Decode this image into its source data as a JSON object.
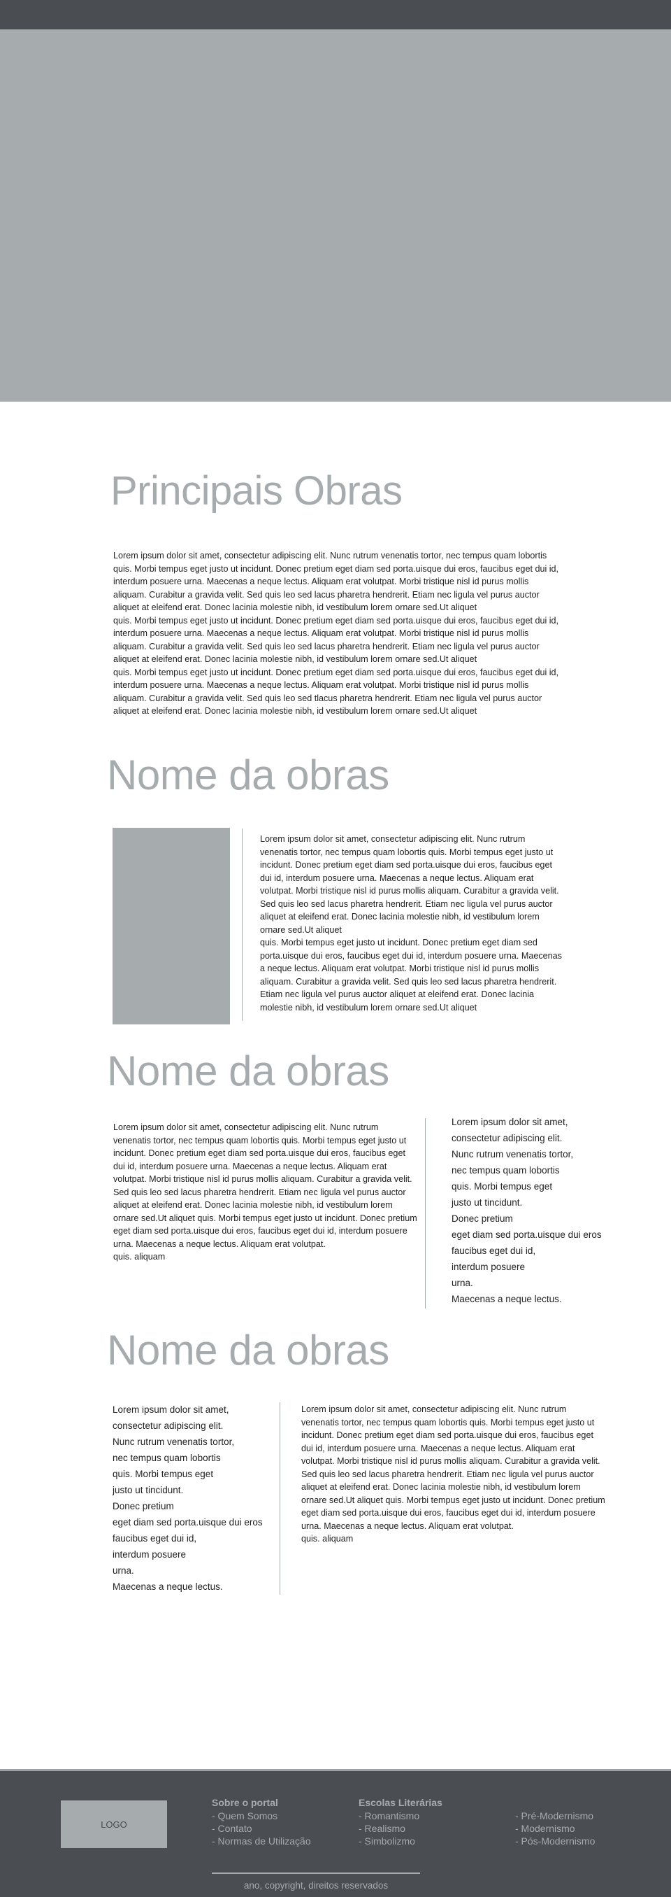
{
  "main": {
    "title": "Principais Obras",
    "intro_text": "Lorem ipsum dolor sit amet, consectetur adipiscing elit.  Nunc rutrum venenatis tortor, nec tempus quam lobortis\nquis. Morbi tempus eget justo ut incidunt. Donec pretium eget diam sed porta.uisque dui eros, faucibus eget dui id,\ninterdum posuere urna. Maecenas a neque lectus. Aliquam erat volutpat. Morbi tristique nisl id purus mollis\naliquam. Curabitur a gravida velit. Sed quis leo sed lacus pharetra hendrerit. Etiam nec ligula vel purus auctor\naliquet at eleifend erat. Donec lacinia molestie nibh, id vestibulum lorem ornare sed.Ut aliquet\nquis. Morbi tempus eget justo ut incidunt. Donec pretium eget diam sed porta.uisque dui eros, faucibus eget dui id,\ninterdum posuere urna. Maecenas a neque lectus. Aliquam erat volutpat. Morbi tristique nisl id purus mollis\naliquam. Curabitur a gravida velit. Sed quis leo sed lacus pharetra hendrerit. Etiam nec ligula vel purus auctor\naliquet at eleifend erat. Donec lacinia molestie nibh, id vestibulum lorem ornare sed.Ut aliquet\nquis. Morbi tempus eget justo ut incidunt. Donec pretium eget diam sed porta.uisque dui eros, faucibus eget dui id,\ninterdum posuere urna. Maecenas a neque lectus. Aliquam erat volutpat. Morbi tristique nisl id purus mollis\naliquam. Curabitur a gravida velit. Sed quis leo sed tlacus pharetra hendrerit. Etiam nec ligula vel purus auctor\naliquet at eleifend erat. Donec lacinia molestie nibh, id vestibulum lorem ornare sed.Ut aliquet"
  },
  "section1": {
    "title": "Nome da obras",
    "text": "Lorem ipsum dolor sit amet, consectetur adipiscing elit.  Nunc rutrum\nvenenatis tortor, nec tempus quam lobortis  quis. Morbi tempus eget justo ut\nincidunt. Donec pretium eget diam sed porta.uisque dui eros, faucibus eget\ndui id, interdum posuere urna. Maecenas a neque lectus. Aliquam erat\nvolutpat. Morbi tristique nisl id purus mollis aliquam. Curabitur a gravida velit.\nSed quis leo sed lacus pharetra hendrerit. Etiam nec ligula vel purus auctor\naliquet at eleifend erat. Donec lacinia molestie nibh, id vestibulum lorem\nornare sed.Ut aliquet\nquis. Morbi tempus eget justo ut incidunt. Donec pretium eget diam sed\nporta.uisque dui eros, faucibus eget dui id, interdum posuere urna. Maecenas\na neque lectus. Aliquam erat volutpat. Morbi tristique nisl id purus mollis\naliquam. Curabitur a gravida velit. Sed quis leo sed lacus pharetra hendrerit.\nEtiam nec ligula vel purus auctor aliquet at eleifend erat. Donec lacinia\nmolestie nibh, id vestibulum lorem ornare sed.Ut aliquet"
  },
  "section2": {
    "title": "Nome da obras",
    "text": "Lorem ipsum dolor sit amet, consectetur adipiscing elit.  Nunc rutrum\nvenenatis tortor, nec tempus quam lobortis  quis. Morbi tempus eget justo ut\nincidunt. Donec pretium eget diam sed porta.uisque dui eros, faucibus eget\ndui id, interdum posuere urna. Maecenas a neque lectus. Aliquam erat\nvolutpat. Morbi tristique nisl id purus mollis aliquam. Curabitur a gravida velit.\nSed quis leo sed lacus pharetra hendrerit. Etiam nec ligula vel purus auctor\naliquet at eleifend erat. Donec lacinia molestie nibh, id vestibulum lorem\nornare sed.Ut aliquet quis. Morbi tempus eget justo ut incidunt. Donec pretium\neget diam sed porta.uisque dui eros, faucibus eget dui id, interdum posuere\nurna. Maecenas a neque lectus. Aliquam erat volutpat.\nquis. aliquam",
    "side_text": "Lorem ipsum dolor sit amet,\nconsectetur adipiscing elit.\nNunc rutrum venenatis tortor,\nnec tempus quam lobortis\nquis. Morbi tempus eget\njusto ut tincidunt.\nDonec pretium\neget diam sed porta.uisque dui eros\n faucibus eget dui id,\ninterdum posuere\nurna.\nMaecenas a neque lectus."
  },
  "section3": {
    "title": "Nome da obras",
    "side_text": "Lorem ipsum dolor sit amet,\nconsectetur adipiscing elit.\nNunc rutrum venenatis tortor,\nnec tempus quam lobortis\nquis. Morbi tempus eget\njusto ut tincidunt.\nDonec pretium\neget diam sed porta.uisque dui eros\n faucibus eget dui id,\ninterdum posuere\nurna.\nMaecenas a neque lectus.",
    "text": "Lorem ipsum dolor sit amet, consectetur adipiscing elit.  Nunc rutrum\nvenenatis tortor, nec tempus quam lobortis  quis. Morbi tempus eget justo ut\nincidunt. Donec pretium eget diam sed porta.uisque dui eros, faucibus eget\ndui id, interdum posuere urna. Maecenas a neque lectus. Aliquam erat\nvolutpat. Morbi tristique nisl id purus mollis aliquam. Curabitur a gravida velit.\nSed quis leo sed lacus pharetra hendrerit. Etiam nec ligula vel purus auctor\naliquet at eleifend erat. Donec lacinia molestie nibh, id vestibulum lorem\nornare sed.Ut aliquet quis. Morbi tempus eget justo ut incidunt. Donec pretium\neget diam sed porta.uisque dui eros, faucibus eget dui id, interdum posuere\nurna. Maecenas a neque lectus. Aliquam erat volutpat.\nquis. aliquam"
  },
  "footer": {
    "logo": "LOGO",
    "col1": {
      "title": "Sobre o portal",
      "links": [
        "- Quem Somos",
        "- Contato",
        "- Normas de Utilização"
      ]
    },
    "col2": {
      "title": "Escolas Literárias",
      "links": [
        "- Romantismo",
        "- Realismo",
        "- Simbolizmo"
      ]
    },
    "col3": {
      "links": [
        "- Pré-Modernismo",
        "- Modernismo",
        "- Pós-Modernismo"
      ]
    },
    "copyright": "ano, copyright, direitos reservados"
  },
  "colors": {
    "dark": "#4a4d51",
    "gray": "#a6abae"
  }
}
